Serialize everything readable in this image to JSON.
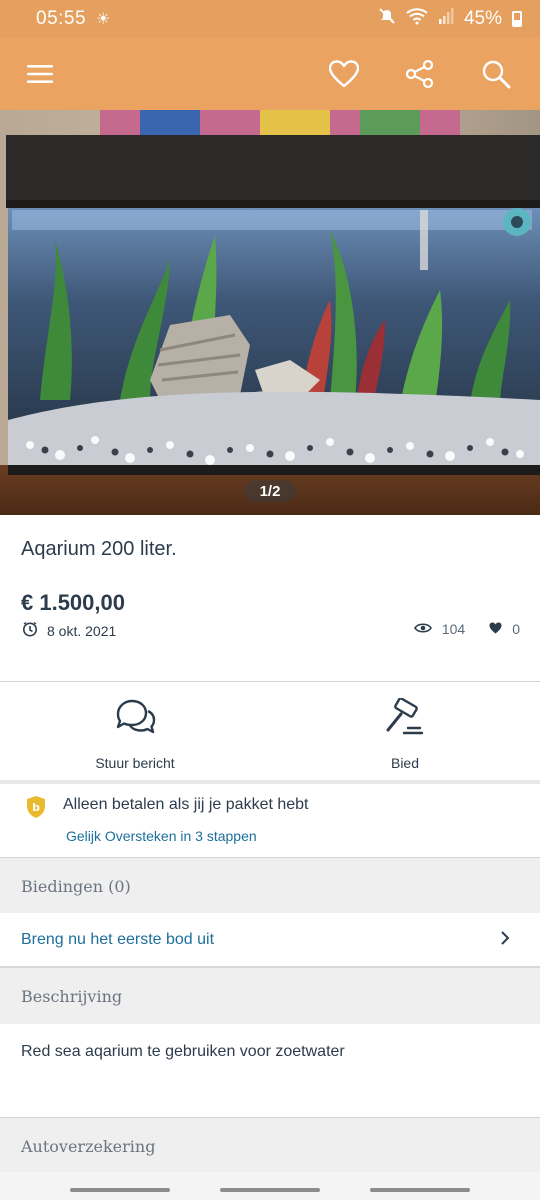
{
  "status_bar": {
    "time": "05:55",
    "battery": "45%"
  },
  "app_bar": {
    "icons": [
      "menu-icon",
      "heart-icon",
      "share-icon",
      "search-icon"
    ]
  },
  "hero": {
    "page_indicator": "1/2"
  },
  "listing": {
    "title": "Aqarium 200 liter.",
    "price": "€ 1.500,00",
    "date": "8 okt. 2021",
    "views": "104",
    "favorites": "0"
  },
  "actions": {
    "message_label": "Stuur bericht",
    "bid_label": "Bied"
  },
  "protection": {
    "text": "Alleen betalen als jij je pakket hebt",
    "link": "Gelijk Oversteken in 3 stappen"
  },
  "bids": {
    "header": "Biedingen (0)",
    "first_bid": "Breng nu het eerste bod uit"
  },
  "description": {
    "header": "Beschrijving",
    "text": "Red sea aqarium te gebruiken voor zoetwater"
  },
  "insurance": {
    "header": "Autoverzekering"
  },
  "colors": {
    "brand": "#eaa360",
    "link": "#1d6f9c",
    "text": "#2d3c4d",
    "shield": "#e9b92e"
  }
}
